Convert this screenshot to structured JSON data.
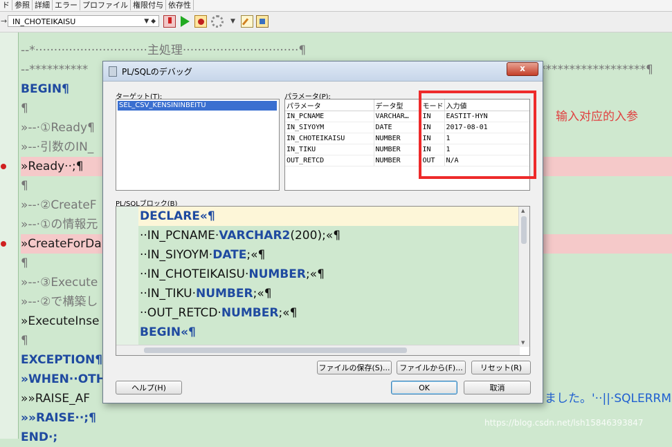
{
  "tabs": [
    "ド",
    "参照",
    "詳細",
    "エラー",
    "プロファイル",
    "権限付与",
    "依存性"
  ],
  "toolbar": {
    "procedure": "IN_CHOTEIKAISU",
    "arrow": "→"
  },
  "editor": {
    "lines": [
      {
        "text": "--*······························主処理·······························¶",
        "style": "cm"
      },
      {
        "text": "--**********",
        "tail": "******************¶",
        "style": "cm"
      },
      {
        "text": "BEGIN¶",
        "style": "kw"
      },
      {
        "text": "¶",
        "style": "cm"
      },
      {
        "text": "»--·①Ready¶",
        "style": "cm"
      },
      {
        "text": "»--·引数のIN_",
        "style": "cm"
      },
      {
        "text": "»Ready··;¶",
        "style": "hl"
      },
      {
        "text": "¶",
        "style": "cm"
      },
      {
        "text": "»--·②CreateF",
        "style": "cm"
      },
      {
        "text": "»--·①の情報元",
        "style": "cm"
      },
      {
        "text": "»CreateForDa",
        "style": "hl"
      },
      {
        "text": "¶",
        "style": "cm"
      },
      {
        "text": "»--·③Execute",
        "style": "cm"
      },
      {
        "text": "»--·②で構築し",
        "style": "cm"
      },
      {
        "text": "»ExecuteInse",
        "style": "plain"
      },
      {
        "text": "¶",
        "style": "cm"
      },
      {
        "text": "EXCEPTION¶",
        "style": "kw"
      },
      {
        "text": "»WHEN··OTH",
        "style": "kw"
      },
      {
        "text": "»»RAISE_AF",
        "tail": "ました。'··||·SQLERRM",
        "style": "plain"
      },
      {
        "text": "»»RAISE··;¶",
        "style": "kw"
      },
      {
        "text": "END·;",
        "style": "kw"
      }
    ]
  },
  "dialog": {
    "title": "PL/SQLのデバッグ",
    "close_label": "x",
    "target_label": "ターゲット(T):",
    "target_item": "SEL_CSV_KENSININBEITU",
    "param_label": "パラメータ(P):",
    "param_headers": [
      "パラメータ",
      "データ型",
      "モード",
      "入力値"
    ],
    "params": [
      {
        "name": "IN_PCNAME",
        "type": "VARCHAR…",
        "mode": "IN",
        "value": "EASTIT-HYN"
      },
      {
        "name": "IN_SIYOYM",
        "type": "DATE",
        "mode": "IN",
        "value": "2017-08-01"
      },
      {
        "name": "IN_CHOTEIKAISU",
        "type": "NUMBER",
        "mode": "IN",
        "value": "1"
      },
      {
        "name": "IN_TIKU",
        "type": "NUMBER",
        "mode": "IN",
        "value": "1"
      },
      {
        "name": "OUT_RETCD",
        "type": "NUMBER",
        "mode": "OUT",
        "value": "N/A"
      }
    ],
    "annotation": "输入对应的入参",
    "plsql_label": "PL/SQLブロック(B)",
    "code": [
      {
        "text": "DECLARE«¶",
        "style": "kw"
      },
      {
        "text": "··IN_PCNAME·",
        "kwtext": "VARCHAR2",
        "tail": "(200);«¶"
      },
      {
        "text": "··IN_SIYOYM·",
        "kwtext": "DATE",
        "tail": ";«¶"
      },
      {
        "text": "··IN_CHOTEIKAISU·",
        "kwtext": "NUMBER",
        "tail": ";«¶"
      },
      {
        "text": "··IN_TIKU·",
        "kwtext": "NUMBER",
        "tail": ";«¶"
      },
      {
        "text": "··OUT_RETCD·",
        "kwtext": "NUMBER",
        "tail": ";«¶"
      },
      {
        "text": "BEGIN«¶",
        "style": "kw"
      }
    ],
    "buttons": {
      "save_file": "ファイルの保存(S)...",
      "from_file": "ファイルから(F)...",
      "reset": "リセット(R)",
      "help": "ヘルプ(H)",
      "ok": "OK",
      "cancel": "取消"
    }
  },
  "watermark": "https://blog.csdn.net/lsh15846393847"
}
